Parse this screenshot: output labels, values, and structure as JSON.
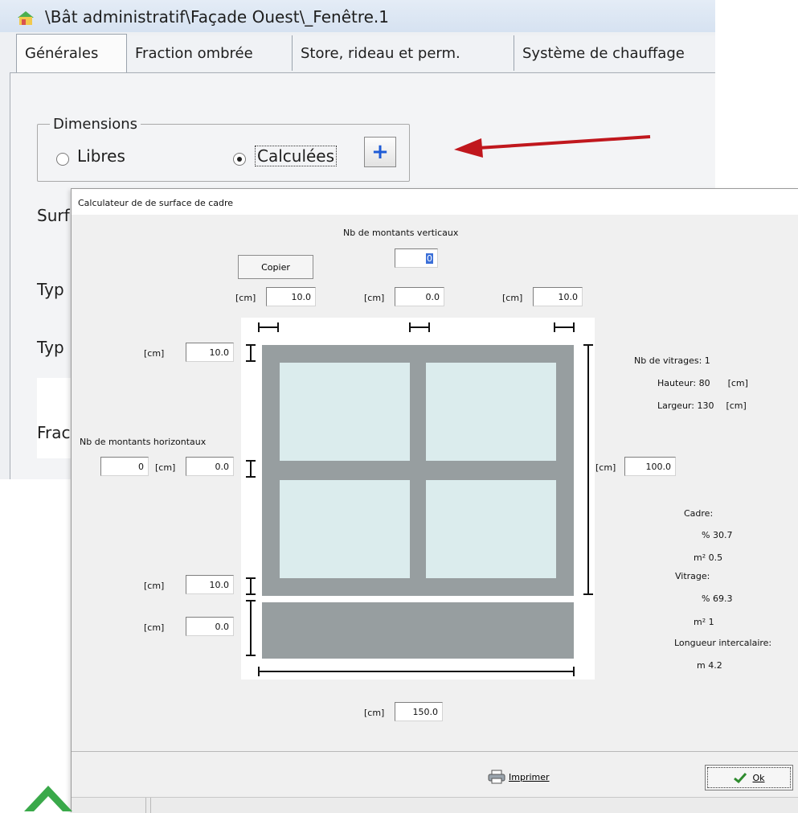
{
  "background_window": {
    "title": "\\Bât administratif\\Façade Ouest\\_Fenêtre.1",
    "tabs": [
      "Générales",
      "Fraction ombrée",
      "Store, rideau et perm.",
      "Système de chauffage"
    ],
    "dimensions": {
      "legend": "Dimensions",
      "option_free": "Libres",
      "option_calculated": "Calculées",
      "selected": "Calculées",
      "plus_button": "+"
    },
    "labels_cut": [
      "Surf",
      "Typ",
      "Typ",
      "Frac"
    ]
  },
  "dialog": {
    "title": "Calculateur de de surface de cadre",
    "vertical_mullions": {
      "label": "Nb de montants verticaux",
      "value": "0"
    },
    "copy_button": "Copier",
    "top_fields": [
      {
        "unit": "[cm]",
        "value": "10.0"
      },
      {
        "unit": "[cm]",
        "value": "0.0"
      },
      {
        "unit": "[cm]",
        "value": "10.0"
      }
    ],
    "left_top_field": {
      "unit": "[cm]",
      "value": "10.0"
    },
    "horizontal_mullions": {
      "label": "Nb de montants horizontaux",
      "value": "0",
      "unit": "[cm]",
      "width_value": "0.0"
    },
    "left_bottom_field": {
      "unit": "[cm]",
      "value": "10.0"
    },
    "left_sill_field": {
      "unit": "[cm]",
      "value": "0.0"
    },
    "height_field": {
      "unit": "[cm]",
      "value": "100.0"
    },
    "width_field": {
      "unit": "[cm]",
      "value": "150.0"
    },
    "glazing_info": {
      "count_label": "Nb de vitrages:",
      "count": "1",
      "height_label": "Hauteur:",
      "height": "80",
      "height_unit": "[cm]",
      "width_label": "Largeur:",
      "width": "130",
      "width_unit": "[cm]"
    },
    "results": {
      "frame_label": "Cadre:",
      "frame_pct_unit": "%",
      "frame_pct": "30.7",
      "frame_area_unit": "m²",
      "frame_area": "0.5",
      "glazing_label": "Vitrage:",
      "glazing_pct_unit": "%",
      "glazing_pct": "69.3",
      "glazing_area_unit": "m²",
      "glazing_area": "1",
      "spacer_label": "Longueur intercalaire:",
      "spacer_unit": "m",
      "spacer_value": "4.2"
    },
    "print_button": "Imprimer",
    "ok_button": "Ok"
  },
  "colors": {
    "frame": "#979ea0",
    "glass": "#dbeced",
    "arrow": "#c0171d",
    "plus": "#1e5bd6"
  }
}
